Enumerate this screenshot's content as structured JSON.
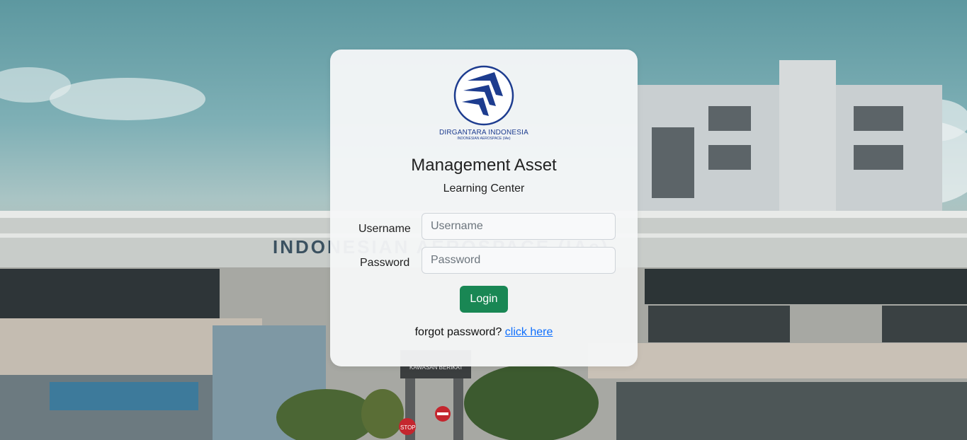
{
  "logo": {
    "name": "DIRGANTARA INDONESIA",
    "subname": "INDONESIAN AEROSPACE (IAe)"
  },
  "title": "Management Asset",
  "subtitle": "Learning Center",
  "form": {
    "username_label": "Username",
    "username_placeholder": "Username",
    "username_value": "",
    "password_label": "Password",
    "password_placeholder": "Password",
    "password_value": "",
    "login_button": "Login"
  },
  "forgot": {
    "text": "forgot password?",
    "link_text": "click here"
  },
  "background": {
    "building_sign": "INDONESIAN AEROSPACE (IAe)",
    "gate_sign": "KAWASAN BERIKAT",
    "stop_sign": "STOP"
  },
  "colors": {
    "accent_green": "#198754",
    "link_blue": "#0d6efd",
    "logo_blue": "#1d3c8f"
  }
}
